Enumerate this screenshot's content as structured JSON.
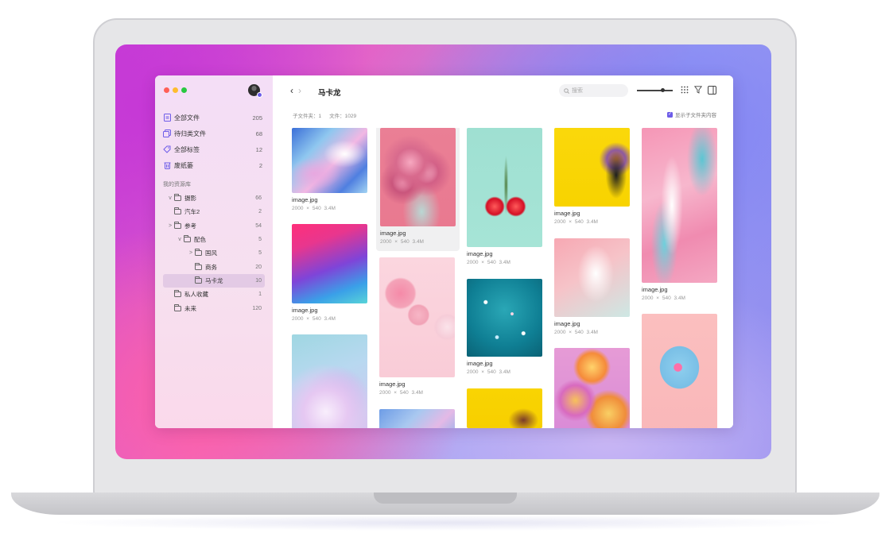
{
  "window": {
    "traffic_colors": [
      "#ff5f57",
      "#febc2e",
      "#28c840"
    ],
    "avatar": "user-avatar"
  },
  "sidebar": {
    "items": [
      {
        "label": "全部文件",
        "count": "205",
        "icon": "file-icon"
      },
      {
        "label": "待归类文件",
        "count": "68",
        "icon": "files-icon"
      },
      {
        "label": "全部标签",
        "count": "12",
        "icon": "tag-icon"
      },
      {
        "label": "废纸篓",
        "count": "2",
        "icon": "trash-icon"
      }
    ],
    "library_title": "我的资源库",
    "tree": [
      {
        "label": "摄影",
        "count": "66",
        "expander": "v"
      },
      {
        "label": "汽车2",
        "count": "2",
        "expander": ""
      },
      {
        "label": "参考",
        "count": "54",
        "expander": ">"
      },
      {
        "label": "配色",
        "count": "5",
        "expander": "v"
      },
      {
        "label": "国风",
        "count": "5",
        "expander": ">"
      },
      {
        "label": "商务",
        "count": "20",
        "expander": ""
      },
      {
        "label": "马卡龙",
        "count": "10",
        "expander": ""
      },
      {
        "label": "私人收藏",
        "count": "1",
        "expander": ""
      },
      {
        "label": "未来",
        "count": "120",
        "expander": ""
      }
    ]
  },
  "toolbar": {
    "back": "‹",
    "forward": "›",
    "title": "马卡龙",
    "search_placeholder": "搜索",
    "grid_icon": "grid-icon",
    "filter_icon": "filter-icon",
    "panel_icon": "panel-toggle-icon"
  },
  "stats": {
    "subfolders": "子文件夹：1",
    "files": "文件：1029"
  },
  "show_subfolder_content": "显示子文件夹内容",
  "images": [
    {
      "name": "image.jpg",
      "meta": "2000 × 540  3.4M"
    },
    {
      "name": "image.jpg",
      "meta": "2000 × 540  3.4M"
    },
    {
      "name": "image.jpg",
      "meta": "2000 × 540  3.4M"
    },
    {
      "name": "image.jpg",
      "meta": "2000 × 540  3.4M"
    },
    {
      "name": "image.jpg",
      "meta": "2000 × 540  3.4M"
    },
    {
      "name": "image.jpg",
      "meta": "2000 × 540  3.4M"
    },
    {
      "name": "image.jpg",
      "meta": "2000 × 540  3.4M"
    },
    {
      "name": "image.jpg",
      "meta": "2000 × 540  3.4M"
    },
    {
      "name": "image.jpg",
      "meta": "2000 × 540  3.4M"
    },
    {
      "name": "image.jpg",
      "meta": "2000 × 540  3.4M"
    }
  ],
  "accent": "#6d5ce8"
}
